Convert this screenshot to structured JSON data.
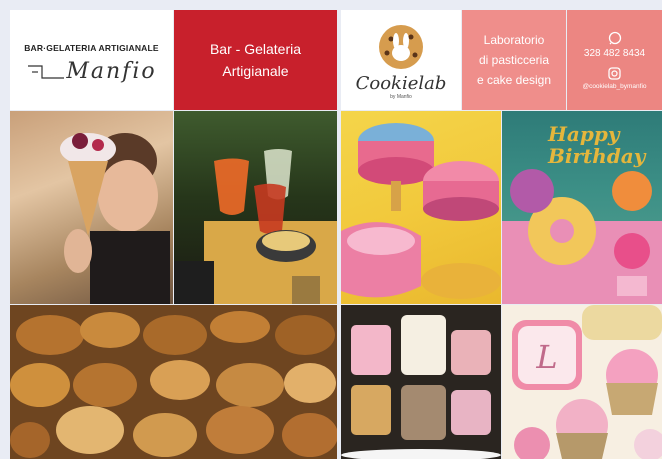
{
  "left_panel": {
    "logo": {
      "top_text": "BAR·GELATERIA ARTIGIANALE",
      "brand": "Manfio"
    },
    "red_box": {
      "line1": "Bar - Gelateria",
      "line2": "Artigianale"
    }
  },
  "right_panel": {
    "logo": {
      "brand": "Cookielab",
      "by": "by Manfio"
    },
    "lab_box": {
      "line1": "Laboratorio",
      "line2": "di pasticceria",
      "line3": "e cake design"
    },
    "contact": {
      "phone": "328 482 8434",
      "instagram": "@cookielab_bymanfio"
    }
  },
  "photos": {
    "gelato": "gelato-photo",
    "spritz": "spritz-photo",
    "pastries": "pastries-photo",
    "cakes": "cakes-photo",
    "birthday": "birthday-cake-photo",
    "petitfours": "petit-fours-photo",
    "cookies": "decorated-cookies-photo",
    "birthday_text": "Happy Birthday"
  },
  "colors": {
    "red": "#c8202c",
    "pink": "#ef8e8b",
    "background": "#e9ecf4"
  }
}
